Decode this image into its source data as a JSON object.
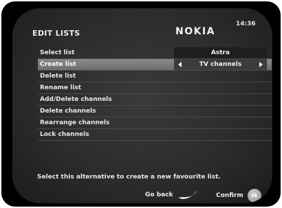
{
  "screen": {
    "title": "EDIT LISTS",
    "brand": "NOKIA",
    "clock": "14:36"
  },
  "menu": {
    "items": [
      {
        "label": "Select list",
        "value": "Astra",
        "selected": false
      },
      {
        "label": "Create list",
        "value": "TV channels",
        "selected": true
      },
      {
        "label": "Delete list",
        "value": "",
        "selected": false
      },
      {
        "label": "Rename list",
        "value": "",
        "selected": false
      },
      {
        "label": "Add/Delete channels",
        "value": "",
        "selected": false
      },
      {
        "label": "Delete channels",
        "value": "",
        "selected": false
      },
      {
        "label": "Rearrange channels",
        "value": "",
        "selected": false
      },
      {
        "label": "Lock channels",
        "value": "",
        "selected": false
      }
    ]
  },
  "hint": "Select this alternative to create a new favourite list.",
  "footer": {
    "back_label": "Go back",
    "back_icon": "back-swoosh-icon",
    "confirm_label": "Confirm",
    "ok_icon_text": "ok"
  }
}
